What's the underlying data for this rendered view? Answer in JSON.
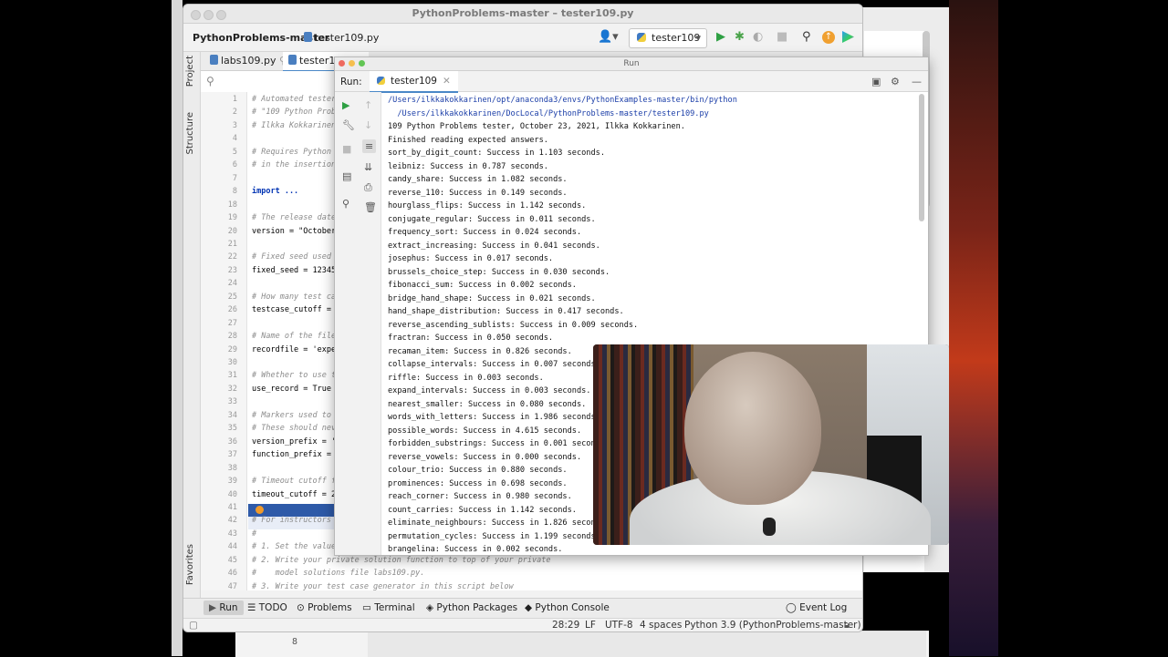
{
  "ide": {
    "window_title": "PythonProblems-master – tester109.py",
    "project_name": "PythonProblems-master",
    "breadcrumb_file": "tester109.py",
    "run_config": "tester109",
    "left_tabs": [
      "Project",
      "Structure",
      "Favorites"
    ],
    "editor_tabs": [
      "labs109.py",
      "tester109.py"
    ],
    "code_lines": [
      {
        "n": "1",
        "text": "# Automated tester"
      },
      {
        "n": "2",
        "text": "# \"109 Python Prob"
      },
      {
        "n": "3",
        "text": "# Ilkka Kokkarinen,"
      },
      {
        "n": "4",
        "text": ""
      },
      {
        "n": "5",
        "text": "# Requires Python"
      },
      {
        "n": "6",
        "text": "# in the insertion"
      },
      {
        "n": "7",
        "text": ""
      },
      {
        "n": "8",
        "text": "import ..."
      },
      {
        "n": "18",
        "text": ""
      },
      {
        "n": "19",
        "text": "# The release date"
      },
      {
        "n": "20",
        "text": "version = \"October"
      },
      {
        "n": "21",
        "text": ""
      },
      {
        "n": "22",
        "text": "# Fixed seed used"
      },
      {
        "n": "23",
        "text": "fixed_seed = 12345"
      },
      {
        "n": "24",
        "text": ""
      },
      {
        "n": "25",
        "text": "# How many test ca"
      },
      {
        "n": "26",
        "text": "testcase_cutoff = "
      },
      {
        "n": "27",
        "text": ""
      },
      {
        "n": "28",
        "text": "# Name of the file"
      },
      {
        "n": "29",
        "text": "recordfile = 'expe"
      },
      {
        "n": "30",
        "text": ""
      },
      {
        "n": "31",
        "text": "# Whether to use t"
      },
      {
        "n": "32",
        "text": "use_record = True"
      },
      {
        "n": "33",
        "text": ""
      },
      {
        "n": "34",
        "text": "# Markers used to"
      },
      {
        "n": "35",
        "text": "# These should nev"
      },
      {
        "n": "36",
        "text": "version_prefix = '"
      },
      {
        "n": "37",
        "text": "function_prefix = "
      },
      {
        "n": "38",
        "text": ""
      },
      {
        "n": "39",
        "text": "# Timeout cutoff f"
      },
      {
        "n": "40",
        "text": "timeout_cutoff = 20"
      },
      {
        "n": "41",
        "text": ""
      },
      {
        "n": "42",
        "text": "# For instructors"
      },
      {
        "n": "43",
        "text": "#"
      },
      {
        "n": "44",
        "text": "# 1. Set the value"
      },
      {
        "n": "45",
        "text": "# 2. Write your private solution function to top of your private"
      },
      {
        "n": "46",
        "text": "#    model solutions file labs109.py."
      },
      {
        "n": "47",
        "text": "# 3. Write your test case generator in this script below"
      }
    ],
    "bottom_tools": [
      "Run",
      "TODO",
      "Problems",
      "Terminal",
      "Python Packages",
      "Python Console",
      "Event Log"
    ],
    "status": {
      "position": "28:29",
      "line_sep": "LF",
      "encoding": "UTF-8",
      "indent": "4 spaces",
      "interpreter": "Python 3.9 (PythonProblems-master)"
    }
  },
  "run": {
    "window_title": "Run",
    "label": "Run:",
    "tab": "tester109",
    "console": [
      "/Users/ilkkakokkarinen/opt/anaconda3/envs/PythonExamples-master/bin/python",
      "  /Users/ilkkakokkarinen/DocLocal/PythonProblems-master/tester109.py",
      "109 Python Problems tester, October 23, 2021, Ilkka Kokkarinen.",
      "Finished reading expected answers.",
      "sort_by_digit_count: Success in 1.103 seconds.",
      "leibniz: Success in 0.787 seconds.",
      "candy_share: Success in 1.082 seconds.",
      "reverse_110: Success in 0.149 seconds.",
      "hourglass_flips: Success in 1.142 seconds.",
      "conjugate_regular: Success in 0.011 seconds.",
      "frequency_sort: Success in 0.024 seconds.",
      "extract_increasing: Success in 0.041 seconds.",
      "josephus: Success in 0.017 seconds.",
      "brussels_choice_step: Success in 0.030 seconds.",
      "fibonacci_sum: Success in 0.002 seconds.",
      "bridge_hand_shape: Success in 0.021 seconds.",
      "hand_shape_distribution: Success in 0.417 seconds.",
      "reverse_ascending_sublists: Success in 0.009 seconds.",
      "fractran: Success in 0.050 seconds.",
      "recaman_item: Success in 0.826 seconds.",
      "collapse_intervals: Success in 0.007 seconds",
      "riffle: Success in 0.003 seconds.",
      "expand_intervals: Success in 0.003 seconds.",
      "nearest_smaller: Success in 0.080 seconds.",
      "words_with_letters: Success in 1.986 seconds",
      "possible_words: Success in 4.615 seconds.",
      "forbidden_substrings: Success in 0.001 secon",
      "reverse_vowels: Success in 0.000 seconds.",
      "colour_trio: Success in 0.880 seconds.",
      "prominences: Success in 0.698 seconds.",
      "reach_corner: Success in 0.980 seconds.",
      "count_carries: Success in 1.142 seconds.",
      "eliminate_neighbours: Success in 1.826 secon",
      "permutation_cycles: Success in 1.199 seconds",
      "brangelina: Success in 0.002 seconds."
    ]
  },
  "footer": {
    "number": "8"
  },
  "icons": {
    "play": "play-icon",
    "debug": "bug-icon",
    "search": "search-icon",
    "settings": "gear-icon"
  },
  "colors": {
    "accent": "#4a88c7",
    "run_green": "#2ea043",
    "console_path": "#1b3ea8"
  }
}
